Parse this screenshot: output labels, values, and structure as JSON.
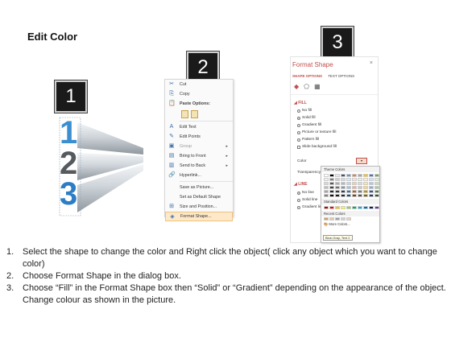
{
  "title": "Edit Color",
  "steps": [
    {
      "badge": "1"
    },
    {
      "badge": "2"
    },
    {
      "badge": "3"
    }
  ],
  "graphic": {
    "digits": [
      "1",
      "2",
      "3"
    ]
  },
  "context_menu": {
    "items": [
      {
        "icon": "cut-icon",
        "glyph": "✂",
        "label": "Cut"
      },
      {
        "icon": "copy-icon",
        "glyph": "⎘",
        "label": "Copy"
      },
      {
        "icon": "paste-icon",
        "glyph": "📋",
        "label": "Paste Options:"
      },
      {
        "icon": "edit-text-icon",
        "glyph": "A",
        "label": "Edit Text"
      },
      {
        "icon": "edit-points-icon",
        "glyph": "✎",
        "label": "Edit Points"
      },
      {
        "icon": "group-icon",
        "glyph": "▣",
        "label": "Group"
      },
      {
        "icon": "bring-front-icon",
        "glyph": "▤",
        "label": "Bring to Front"
      },
      {
        "icon": "send-back-icon",
        "glyph": "▥",
        "label": "Send to Back"
      },
      {
        "icon": "hyperlink-icon",
        "glyph": "🔗",
        "label": "Hyperlink..."
      },
      {
        "label": "Save as Picture..."
      },
      {
        "label": "Set as Default Shape"
      },
      {
        "icon": "size-position-icon",
        "glyph": "⊞",
        "label": "Size and Position..."
      },
      {
        "icon": "format-shape-icon",
        "glyph": "◈",
        "label": "Format Shape..."
      }
    ]
  },
  "format_panel": {
    "title": "Format Shape",
    "close": "×",
    "tabs": [
      "SHAPE OPTIONS",
      "TEXT OPTIONS"
    ],
    "fill": {
      "header": "FILL",
      "options": [
        "No fill",
        "Solid fill",
        "Gradient fill",
        "Picture or texture fill",
        "Pattern fill",
        "Slide background fill"
      ],
      "selected": "Solid fill",
      "color_label": "Color",
      "transparency_label": "Transparency"
    },
    "line": {
      "header": "LINE",
      "options": [
        "No line",
        "Solid line",
        "Gradient line"
      ],
      "selected": "No line"
    }
  },
  "palette": {
    "theme_header": "Theme Colors",
    "standard_header": "Standard Colors",
    "recent_header": "Recent Colors",
    "more": "More Colors...",
    "tooltip": "Blue-Gray, Text 2",
    "theme_top": [
      "#ffffff",
      "#000000",
      "#e7e6e6",
      "#44546a",
      "#5b9bd5",
      "#ed7d31",
      "#a5a5a5",
      "#ffc000",
      "#4472c4",
      "#70ad47"
    ],
    "theme_shades": [
      [
        "#f2f2f2",
        "#7f7f7f",
        "#d0cece",
        "#d6dce4",
        "#deebf6",
        "#fbe5d5",
        "#ededed",
        "#fff2cc",
        "#dae3f3",
        "#e2efd9"
      ],
      [
        "#d8d8d8",
        "#595959",
        "#aeabab",
        "#adb9ca",
        "#bdd7ee",
        "#f7cbac",
        "#dbdbdb",
        "#fee599",
        "#b4c6e7",
        "#c5e0b3"
      ],
      [
        "#bfbfbf",
        "#3f3f3f",
        "#757070",
        "#8496b0",
        "#9dc3e6",
        "#f4b183",
        "#c9c9c9",
        "#ffd965",
        "#8eaadb",
        "#a8d08d"
      ],
      [
        "#a5a5a5",
        "#262626",
        "#3a3838",
        "#323f4f",
        "#2e75b5",
        "#c55a11",
        "#7b7b7b",
        "#bf9000",
        "#2f5496",
        "#538135"
      ],
      [
        "#7f7f7f",
        "#0c0c0c",
        "#171616",
        "#222a35",
        "#1e4e79",
        "#833c0b",
        "#525252",
        "#7f6000",
        "#1f3864",
        "#375623"
      ]
    ],
    "standard": [
      "#c00000",
      "#ff0000",
      "#ffc000",
      "#ffff00",
      "#92d050",
      "#00b050",
      "#00b0f0",
      "#0070c0",
      "#002060",
      "#7030a0"
    ],
    "recent": [
      "#c8a06a",
      "#e8c9a0",
      "#a0a0a0",
      "#d0d0d0",
      "#f0d0b0"
    ]
  },
  "instructions": [
    {
      "num": "1.",
      "text": "Select the shape to change the color and Right click the object( click any object which you want to change color)"
    },
    {
      "num": "2.",
      "text": "Choose Format Shape in the dialog box."
    },
    {
      "num": "3.",
      "text": "Choose “Fill” in the Format Shape box then “Solid” or “Gradient” depending on the appearance of the object. Change colour as shown in the picture."
    }
  ]
}
